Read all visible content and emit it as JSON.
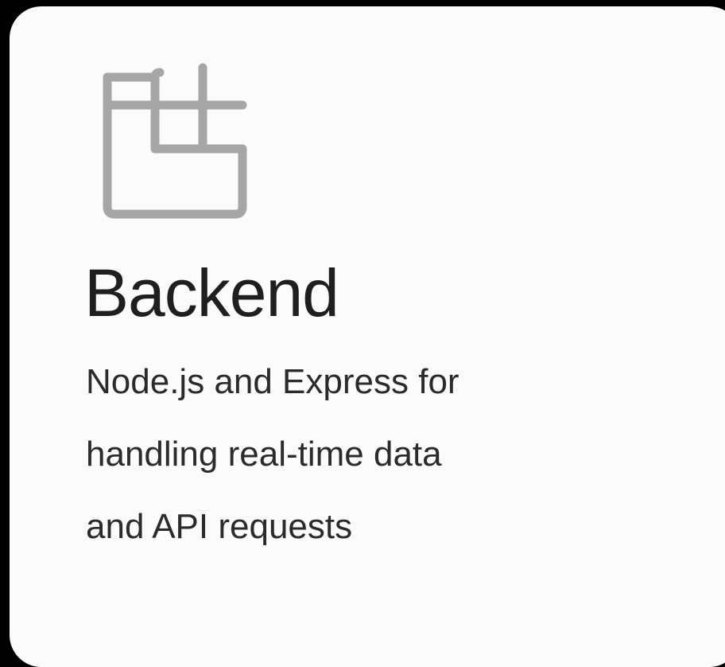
{
  "card": {
    "icon": "layout-blocks-icon",
    "title": "Backend",
    "description_lines": [
      "Node.js and Express for",
      "handling real-time data",
      "and API requests"
    ]
  },
  "colors": {
    "background": "#000000",
    "card": "#fbfbfb",
    "icon_stroke": "#a6a6a6",
    "title": "#1f1f1f",
    "text": "#2b2b2b"
  }
}
